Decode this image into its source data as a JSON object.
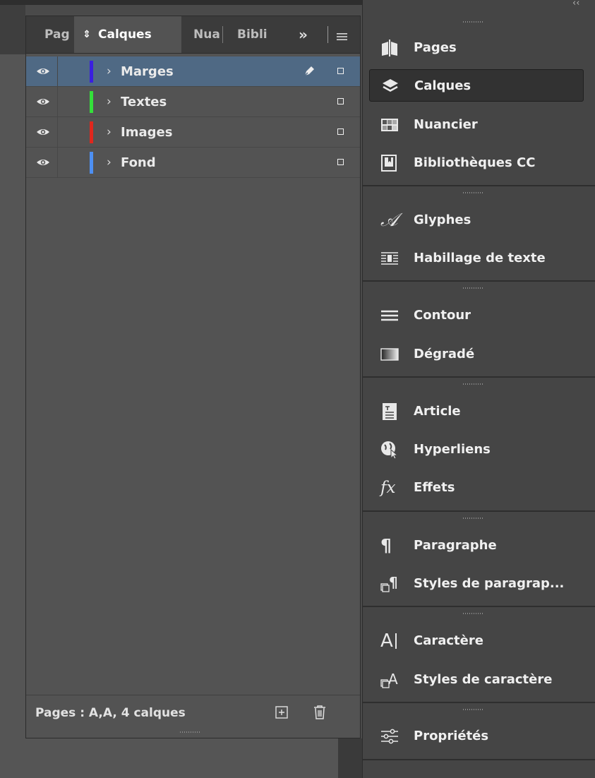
{
  "layers_panel": {
    "tabs": [
      {
        "label": "Pag"
      },
      {
        "label": "Calques"
      },
      {
        "label": "Nua"
      },
      {
        "label": "Bibli"
      }
    ],
    "overflow_label": "»",
    "layers": [
      {
        "name": "Marges",
        "color": "#3a1fe0",
        "visible": true,
        "selected": true
      },
      {
        "name": "Textes",
        "color": "#34e03a",
        "visible": true,
        "selected": false
      },
      {
        "name": "Images",
        "color": "#e0271d",
        "visible": true,
        "selected": false
      },
      {
        "name": "Fond",
        "color": "#4d8ff2",
        "visible": true,
        "selected": false
      }
    ],
    "footer_status": "Pages : A,A, 4 calques"
  },
  "dock": {
    "items": [
      {
        "label": "Pages",
        "icon": "pages-icon"
      },
      {
        "label": "Calques",
        "icon": "layers-icon",
        "active": true
      },
      {
        "label": "Nuancier",
        "icon": "swatches-icon"
      },
      {
        "label": "Bibliothèques CC",
        "icon": "cc-libraries-icon"
      },
      {
        "label": "Glyphes",
        "icon": "glyphs-icon"
      },
      {
        "label": "Habillage de texte",
        "icon": "text-wrap-icon"
      },
      {
        "label": "Contour",
        "icon": "stroke-icon"
      },
      {
        "label": "Dégradé",
        "icon": "gradient-icon"
      },
      {
        "label": "Article",
        "icon": "article-icon"
      },
      {
        "label": "Hyperliens",
        "icon": "hyperlinks-icon"
      },
      {
        "label": "Effets",
        "icon": "effects-icon"
      },
      {
        "label": "Paragraphe",
        "icon": "paragraph-icon"
      },
      {
        "label": "Styles de paragrap...",
        "icon": "paragraph-styles-icon"
      },
      {
        "label": "Caractère",
        "icon": "character-icon"
      },
      {
        "label": "Styles de caractère",
        "icon": "character-styles-icon"
      },
      {
        "label": "Propriétés",
        "icon": "properties-icon"
      }
    ]
  },
  "colors": {
    "selected_row": "#4f6984",
    "panel_bg": "#535353",
    "dock_bg": "#454545"
  }
}
